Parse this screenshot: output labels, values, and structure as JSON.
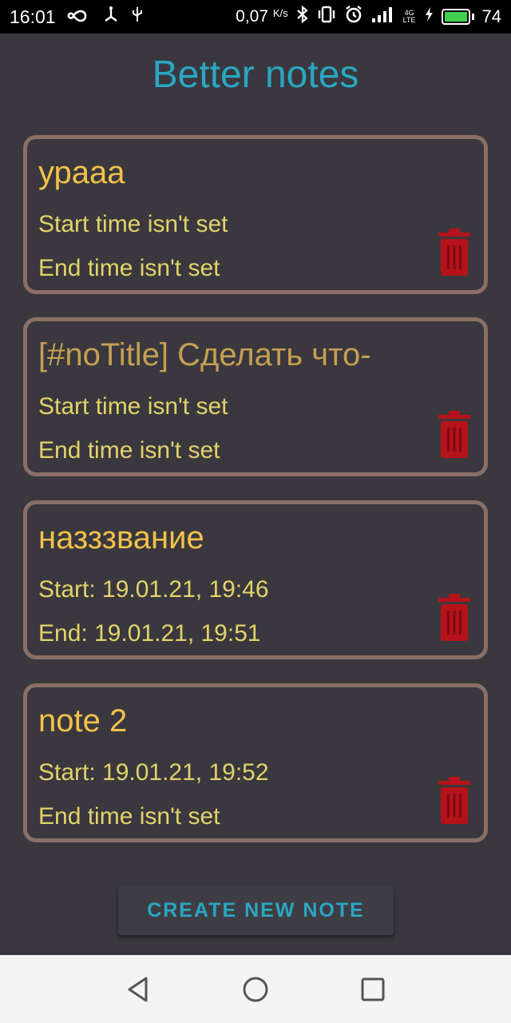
{
  "status_bar": {
    "time": "16:01",
    "speed_value": "0,07",
    "speed_unit": "K/s",
    "network_top": "4G",
    "network_bottom": "LTE",
    "battery_level": "74",
    "icons": [
      "infinity-icon",
      "usb-icon",
      "usb-debug-icon",
      "bluetooth-icon",
      "vibrate-icon",
      "alarm-icon",
      "signal-icon",
      "charging-icon",
      "battery-icon"
    ]
  },
  "app": {
    "title": "Better notes"
  },
  "notes": [
    {
      "title": "урааа",
      "start": "Start time isn't set",
      "end": "End time isn't set",
      "placeholder_title": false
    },
    {
      "title": "[#noTitle] Сделать что-",
      "start": "Start time isn't set",
      "end": "End time isn't set",
      "placeholder_title": true
    },
    {
      "title": "назззвание",
      "start": "Start: 19.01.21, 19:46",
      "end": "End: 19.01.21, 19:51",
      "placeholder_title": false
    },
    {
      "title": "note 2",
      "start": "Start: 19.01.21, 19:52",
      "end": "End time isn't set",
      "placeholder_title": false
    }
  ],
  "actions": {
    "create_label": "CREATE NEW NOTE"
  },
  "colors": {
    "background": "#3a383e",
    "accent": "#2aa7c2",
    "card_border": "#8b6f66",
    "title_text": "#f3c24a",
    "detail_text": "#e2d36a",
    "delete_icon": "#b5121b"
  },
  "nav_bar": {
    "icons": [
      "back-icon",
      "home-icon",
      "recents-icon"
    ]
  }
}
